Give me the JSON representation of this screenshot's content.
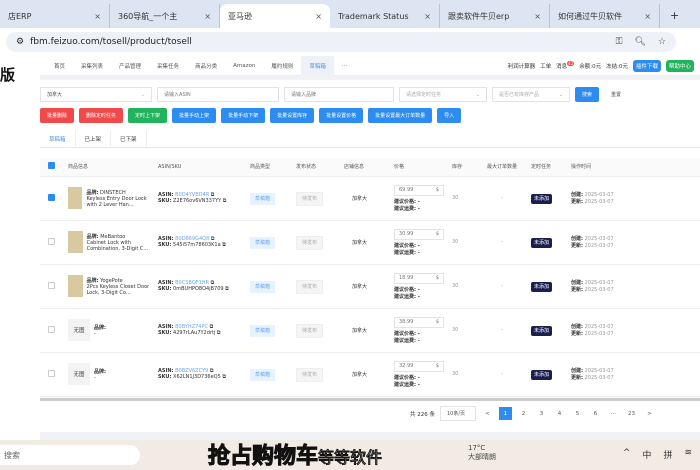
{
  "browser": {
    "tabs": [
      {
        "label": "店ERP"
      },
      {
        "label": "360导航_一个主"
      },
      {
        "label": "亚马逊",
        "active": true
      },
      {
        "label": "Trademark Status"
      },
      {
        "label": "跟卖软件牛贝erp"
      },
      {
        "label": "如何通过牛贝软件"
      }
    ],
    "new_tab": "+",
    "url": "fbm.feizuo.com/tosell/product/tosell"
  },
  "sidebar": {
    "logo": "版"
  },
  "header": {
    "nav": [
      "首页",
      "采集列表",
      "产品管理",
      "采集任务",
      "商品分类",
      "Amazon",
      "履约规则",
      "草稿箱",
      "···"
    ],
    "active_nav": "草稿箱",
    "profit_calc": "利润计算器",
    "ticket": "工单",
    "messages": "消息",
    "msg_badge": "42",
    "balance": "余额:0元",
    "frozen": "冻结:0元",
    "plugin": "插件下载",
    "help": "帮助中心"
  },
  "filters": {
    "country": "加拿大",
    "asin_placeholder": "请输入ASIN",
    "brand_placeholder": "请输入品牌",
    "task_placeholder": "请选择定时任务",
    "stock_placeholder": "是否已有库存产品",
    "search": "搜索",
    "reset": "重置"
  },
  "actions": [
    "批量删除",
    "删除定时任务",
    "定时上下架",
    "批量手动上架",
    "批量手动下架",
    "批量设置库存",
    "批量设置价格",
    "批量设置最大订单数量",
    "导入"
  ],
  "subtabs": [
    "草稿箱",
    "已上架",
    "已下架"
  ],
  "table": {
    "columns": [
      "商品信息",
      "ASIN/SKU",
      "商品类型",
      "发布状态",
      "店铺信息",
      "价格",
      "库存",
      "最大订单数量",
      "定时任务",
      "操作时间"
    ],
    "rows": [
      {
        "img": "",
        "brand": "DINSTECH",
        "title": "Keyless Entry Door Lock with 2 Lever Han...",
        "asin": "B0D4YVBD4R",
        "sku": "Z2E76ov6VN337YY",
        "type": "草稿箱",
        "status": "待发布",
        "store": "加拿大",
        "price": "69.99",
        "stock": "30",
        "max": "-",
        "task": "未添加",
        "created": "2025-03-07",
        "updated": "2025-03-07",
        "checked": true
      },
      {
        "img": "",
        "brand": "MeBantoo",
        "title": "Cabinet Lock with Combination, 3-Digit C...",
        "asin": "B0D869G4Q8",
        "sku": "545i57m78603K1a",
        "type": "草稿箱",
        "status": "待发布",
        "store": "加拿大",
        "price": "30.99",
        "stock": "30",
        "max": "-",
        "task": "未添加",
        "created": "2025-03-07",
        "updated": "2025-03-07"
      },
      {
        "img": "",
        "brand": "YogePote",
        "title": "2Pcs Keyless Closet Door Lock, 3-Digit Co...",
        "asin": "B0CSBQF1HR",
        "sku": "0mBUHPO8O4jB709",
        "type": "草稿箱",
        "status": "待发布",
        "store": "加拿大",
        "price": "18.99",
        "stock": "30",
        "max": "-",
        "task": "未添加",
        "created": "2025-03-07",
        "updated": "2025-03-07"
      },
      {
        "img": "无图",
        "brand": "",
        "title": "-",
        "asin": "B0BYHZ74PC",
        "sku": "4297rLAu7Y2drtj",
        "type": "草稿箱",
        "status": "待发布",
        "store": "加拿大",
        "price": "38.99",
        "stock": "30",
        "max": "-",
        "task": "未添加",
        "created": "2025-03-07",
        "updated": "2025-03-07"
      },
      {
        "img": "无图",
        "brand": "",
        "title": "-",
        "asin": "B0BZV6ZCY9",
        "sku": "X62LN1J3D736eQ5",
        "type": "草稿箱",
        "status": "待发布",
        "store": "加拿大",
        "price": "32.99",
        "stock": "30",
        "max": "-",
        "task": "未添加",
        "created": "2025-03-07",
        "updated": "2025-03-07"
      }
    ],
    "labels": {
      "brand": "品牌:",
      "asin": "ASIN:",
      "sku": "SKU:",
      "currency": "$",
      "suggest_price": "建议价格: -",
      "suggest_ship": "建议运费: -",
      "created": "创建:",
      "updated": "更新:"
    }
  },
  "pagination": {
    "total": "共 226 条",
    "page_size": "10条/页",
    "pages": [
      "1",
      "2",
      "3",
      "4",
      "5",
      "6",
      "···",
      "23"
    ],
    "current": "1",
    "prev": "<",
    "next": ">"
  },
  "taskbar": {
    "search": "搜索",
    "weather_temp": "17°C",
    "weather_desc": "大部晴朗",
    "ime1": "中",
    "ime2": "拼"
  },
  "subtitle": {
    "highlight": "抢占购物车",
    "rest": "等等软件"
  }
}
